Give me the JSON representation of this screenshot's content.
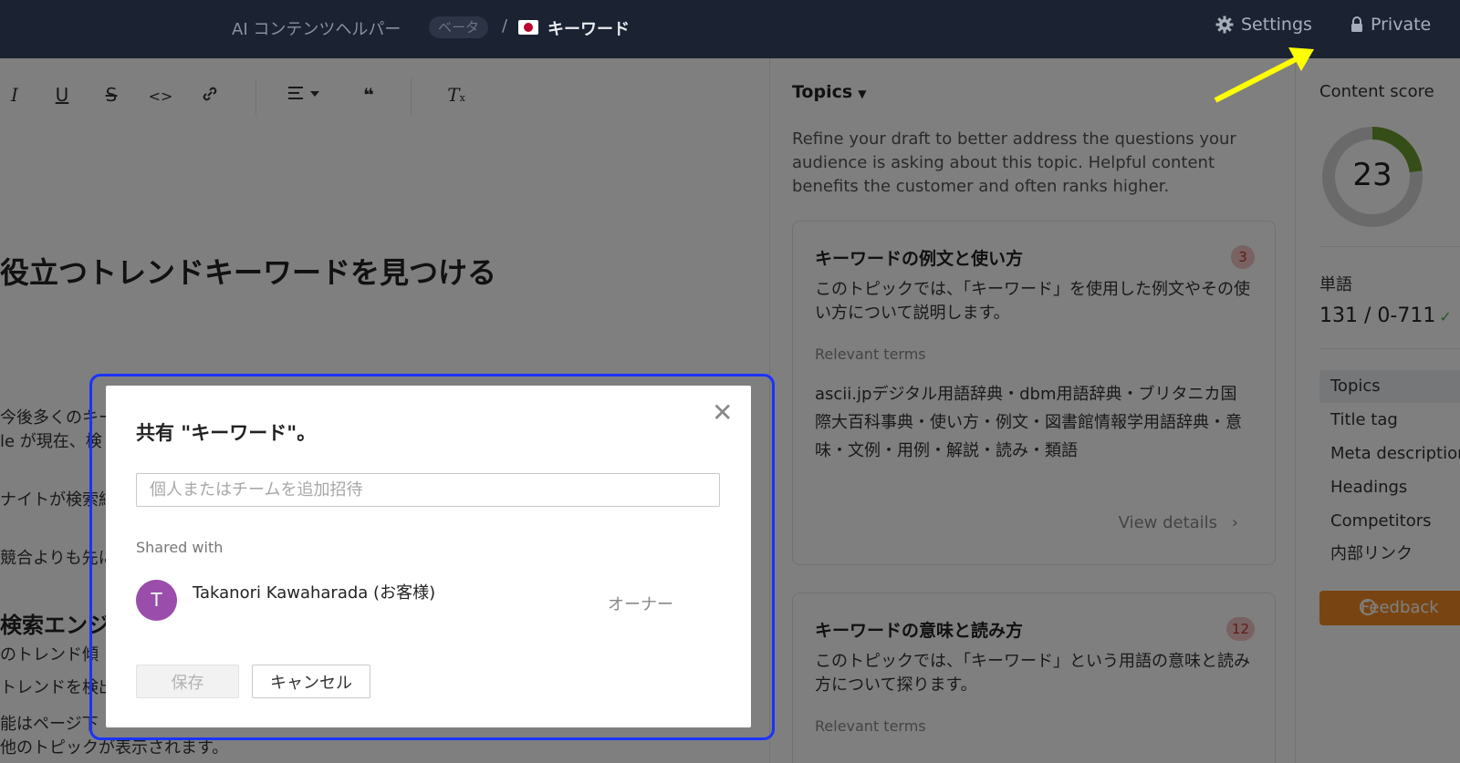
{
  "topbar": {
    "app_name": "AI コンテンツヘルパー",
    "beta_badge": "ベータ",
    "separator": "/",
    "doc_title": "キーワード",
    "settings_label": "Settings",
    "private_label": "Private"
  },
  "editor": {
    "heading": "役立つトレンドキーワードを見つける",
    "lines": [
      "今後多くのキー",
      "le が現在、検",
      "ナイトが検索結",
      "競合よりも先に",
      "のトレンド傾",
      "トレンドを検出",
      "能はページ下",
      "他のトピックが表示されます。"
    ],
    "subheading": "検索エンジ"
  },
  "topics_panel": {
    "header": "Topics",
    "description": "Refine your draft to better address the questions your audience is asking about this topic. Helpful content benefits the customer and often ranks higher.",
    "cards": [
      {
        "title": "キーワードの例文と使い方",
        "badge": "3",
        "description": "このトピックでは、「キーワード」を使用した例文やその使い方について説明します。",
        "relevant_label": "Relevant terms",
        "terms": "ascii.jpデジタル用語辞典・dbm用語辞典・ブリタニカ国際大百科事典・使い方・例文・図書館情報学用語辞典・意味・文例・用例・解説・読み・類語",
        "view_details": "View details"
      },
      {
        "title": "キーワードの意味と読み方",
        "badge": "12",
        "description": "このトピックでは、「キーワード」という用語の意味と読み方について探ります。",
        "relevant_label": "Relevant terms"
      }
    ]
  },
  "score_panel": {
    "label": "Content score",
    "score": "23",
    "score_value": 23,
    "score_max": 100,
    "words_label": "単語",
    "words_value": "131 / 0-711",
    "nav": [
      "Topics",
      "Title tag",
      "Meta description",
      "Headings",
      "Competitors",
      "内部リンク"
    ],
    "feedback": "Feedback"
  },
  "dialog": {
    "title": "共有 \"キーワード\"。",
    "invite_placeholder": "個人またはチームを追加招待",
    "invite_value": "",
    "shared_with": "Shared with",
    "avatar_initial": "T",
    "user_name": "Takanori Kawaharada (お客様)",
    "user_role": "オーナー",
    "save_label": "保存",
    "cancel_label": "キャンセル"
  },
  "colors": {
    "topbar": "#1b2231",
    "avatar": "#9b4dab",
    "feedback": "#f08a24",
    "score_arc": "#6b9a2c",
    "highlight": "#1a33ff",
    "arrow": "#ffff00"
  }
}
